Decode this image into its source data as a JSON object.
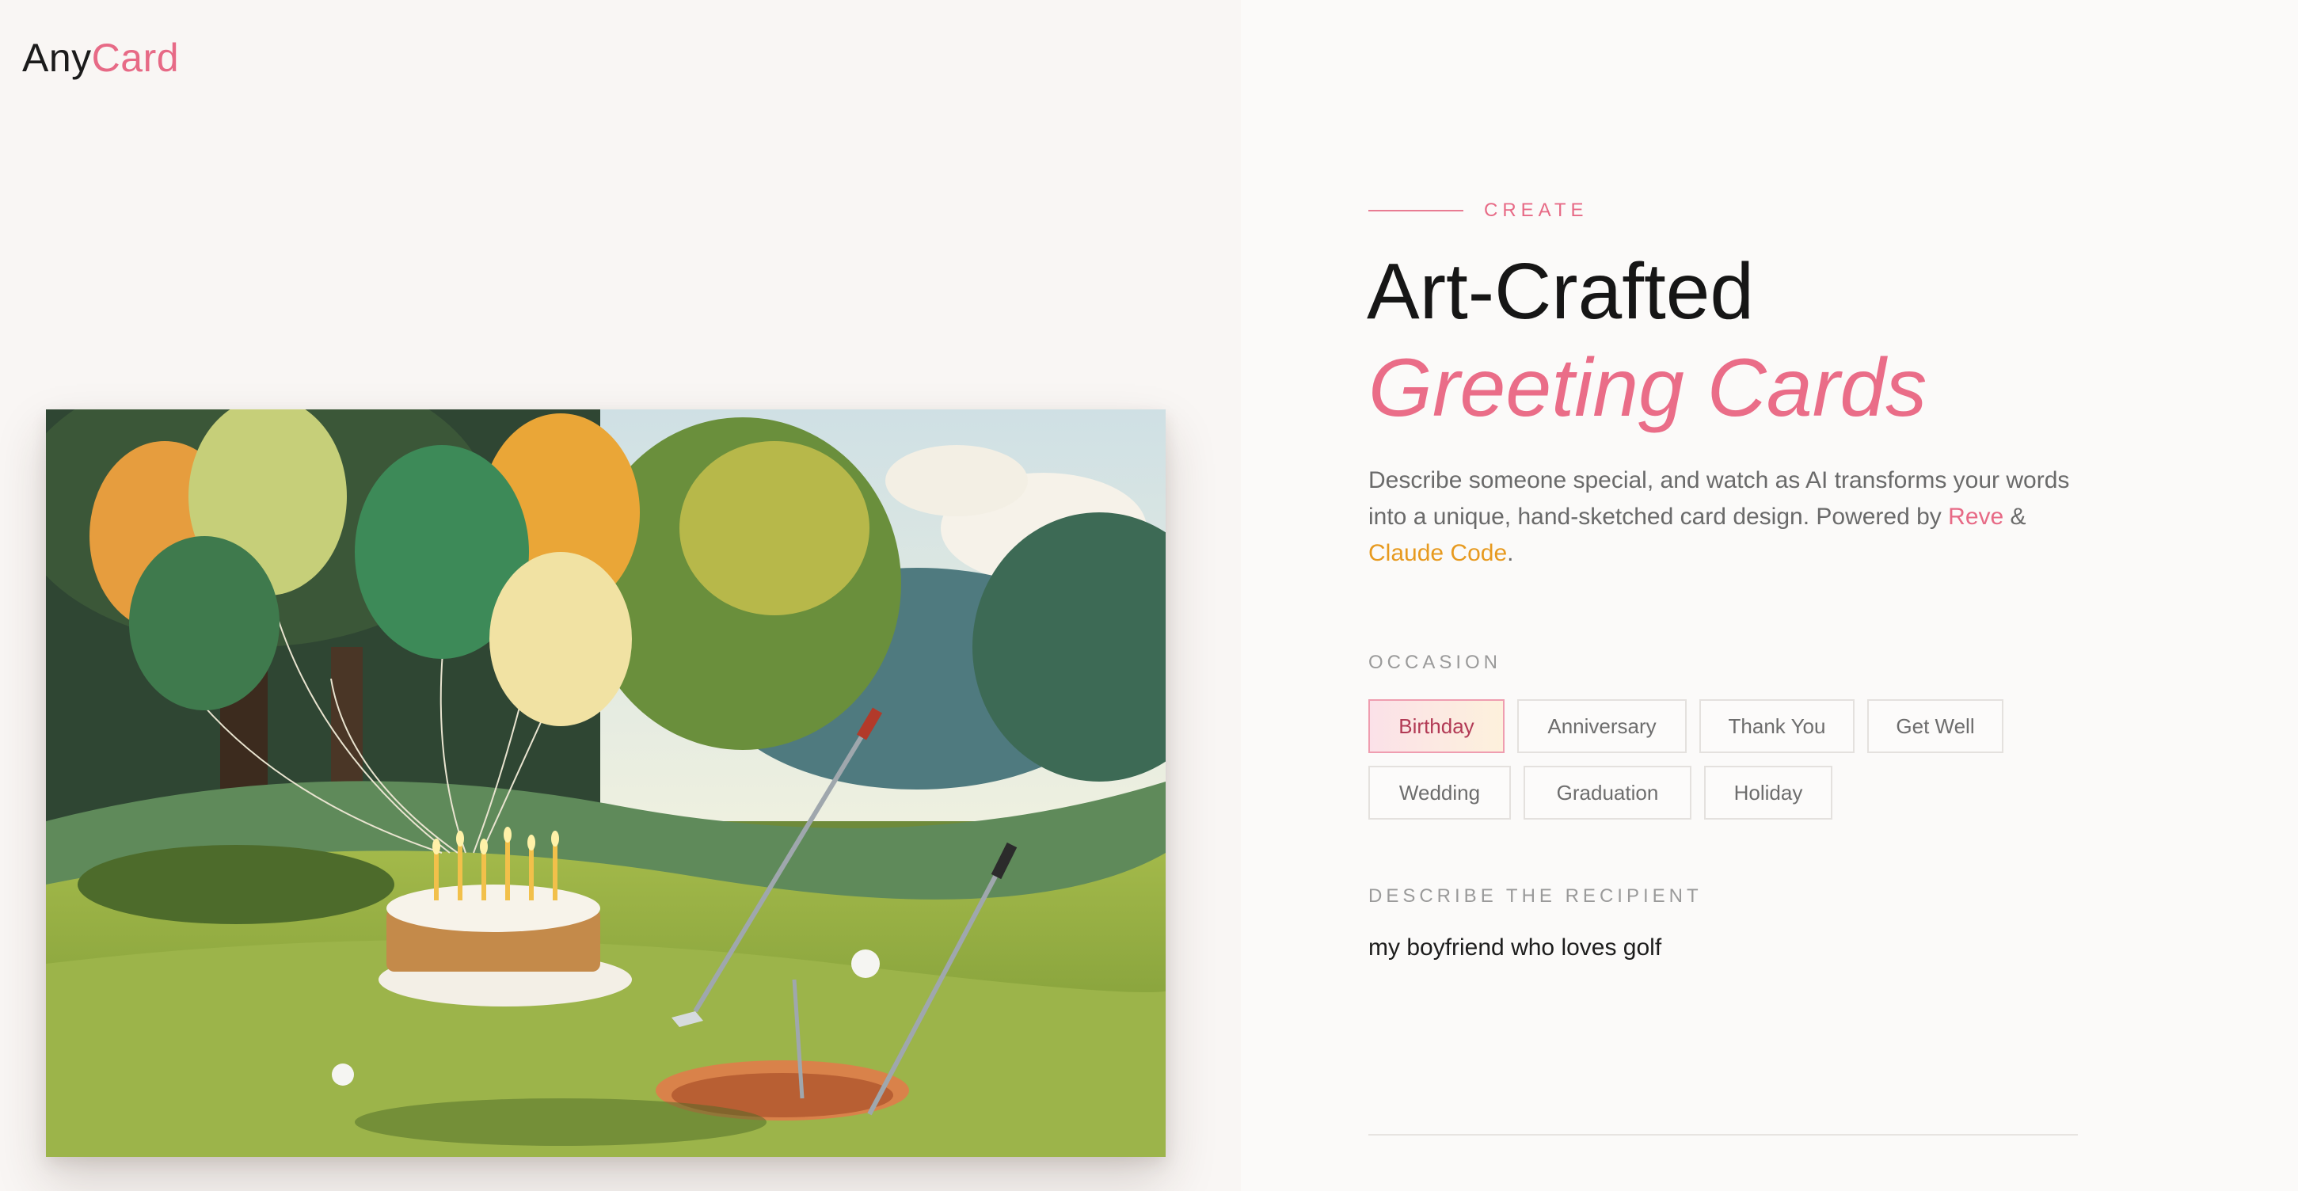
{
  "brand": {
    "name_part1": "Any",
    "name_part2": "Card"
  },
  "colors": {
    "accent_pink": "#e76a86",
    "accent_gold": "#e79a1f",
    "text_dark": "#161616"
  },
  "card_preview": {
    "alt": "Painted birthday card: balloons, a cake with candles, and golf clubs by a hole on a golf course"
  },
  "hero": {
    "eyebrow": "CREATE",
    "title_line1": "Art-Crafted",
    "title_line2": "Greeting Cards",
    "description_prefix": "Describe someone special, and watch as AI transforms your words into a unique, hand-sketched card design. Powered by ",
    "link_reve": "Reve",
    "amp": " & ",
    "link_claude": "Claude Code",
    "period": "."
  },
  "occasion": {
    "label": "OCCASION",
    "options_row1": [
      "Birthday",
      "Anniversary",
      "Thank You",
      "Get Well"
    ],
    "options_row2": [
      "Wedding",
      "Graduation",
      "Holiday"
    ],
    "selected": "Birthday"
  },
  "recipient": {
    "label": "DESCRIBE THE RECIPIENT",
    "value": "my boyfriend who loves golf"
  }
}
